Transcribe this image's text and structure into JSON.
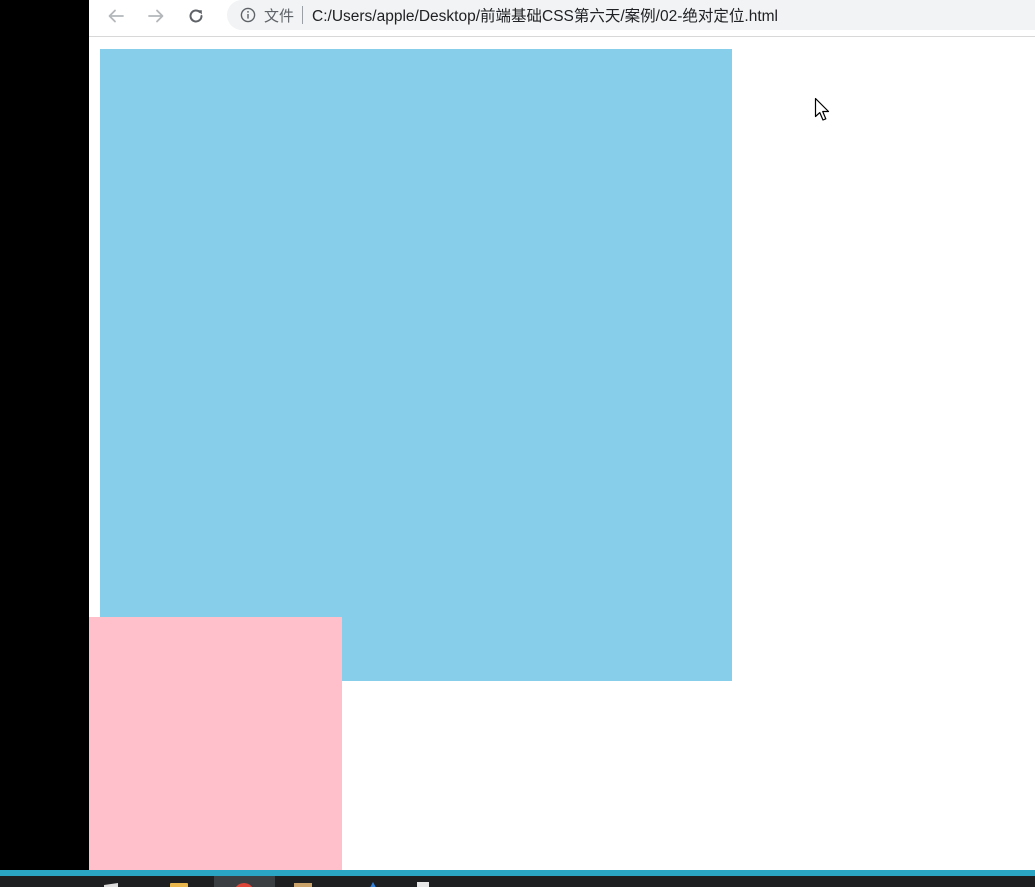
{
  "browser": {
    "back_icon": "arrow-left-icon",
    "forward_icon": "arrow-right-icon",
    "reload_icon": "reload-icon",
    "info_icon": "info-icon",
    "scheme_label": "文件",
    "url": "C:/Users/apple/Desktop/前端基础CSS第六天/案例/02-绝对定位.html"
  },
  "page": {
    "colors": {
      "blue_box": "#87ceeb",
      "pink_box": "#ffc0cb"
    }
  },
  "taskbar": {
    "accent": "#2aa5c4",
    "items": [
      "folder-icon",
      "chrome-icon",
      "image-viewer-icon",
      "app-icon",
      "document-icon"
    ]
  }
}
